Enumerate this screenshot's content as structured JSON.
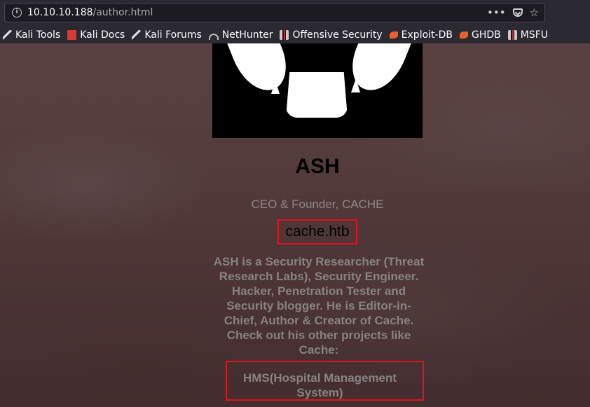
{
  "browser": {
    "url_host": "10.10.10.188",
    "url_path": "/author.html",
    "more_glyph": "•••",
    "star_glyph": "☆",
    "bookmarks": [
      {
        "label": "Kali Tools",
        "icon": "kali-dragon-icon"
      },
      {
        "label": "Kali Docs",
        "icon": "kali-docs-icon"
      },
      {
        "label": "Kali Forums",
        "icon": "kali-dragon-icon"
      },
      {
        "label": "NetHunter",
        "icon": "nethunter-icon"
      },
      {
        "label": "Offensive Security",
        "icon": "offsec-icon"
      },
      {
        "label": "Exploit-DB",
        "icon": "exploitdb-icon"
      },
      {
        "label": "GHDB",
        "icon": "exploitdb-icon"
      },
      {
        "label": "MSFU",
        "icon": "offsec-icon"
      }
    ]
  },
  "author": {
    "name": "ASH",
    "role": "CEO & Founder, CACHE",
    "site": "cache.htb",
    "bio": "ASH is a Security Researcher (Threat Research Labs), Security Engineer. Hacker, Penetration Tester and Security blogger. He is Editor-in-Chief, Author & Creator of Cache. Check out his other projects like Cache:",
    "project": "HMS(Hospital Management System)"
  },
  "colors": {
    "highlight_border": "#e1131c",
    "page_background": "#4f3838",
    "muted_text": "#888283"
  }
}
